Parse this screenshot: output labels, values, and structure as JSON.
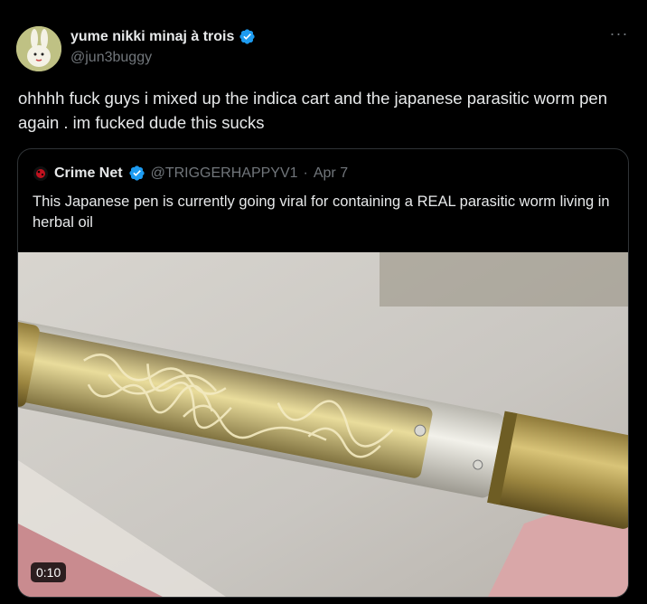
{
  "author": {
    "display_name": "yume nikki minaj à trois",
    "handle": "@jun3buggy",
    "verified_icon": "verified-badge-icon",
    "accent": "#1d9bf0"
  },
  "more_menu_glyph": "···",
  "tweet": {
    "text": "ohhhh fuck guys i mixed up the indica cart and the japanese parasitic worm pen again . im fucked dude this sucks"
  },
  "quote": {
    "display_name": "Crime Net",
    "handle": "@TRIGGERHAPPYV1",
    "separator": "·",
    "date": "Apr 7",
    "text": "This Japanese pen is currently going viral for containing a REAL parasitic worm living in herbal oil",
    "media": {
      "type": "video",
      "duration": "0:10"
    }
  }
}
